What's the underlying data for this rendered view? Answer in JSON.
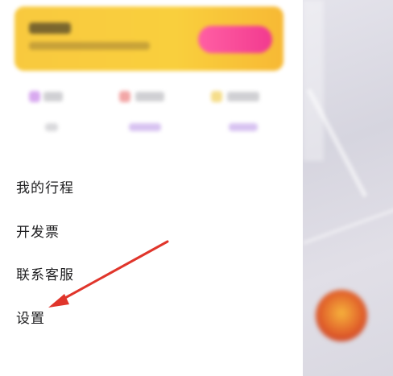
{
  "menu": {
    "items": [
      {
        "label": "我的行程"
      },
      {
        "label": "开发票"
      },
      {
        "label": "联系客服"
      },
      {
        "label": "设置"
      }
    ]
  },
  "colors": {
    "banner": "#f8c93e",
    "banner_button": "#f23a8f",
    "arrow": "#e0352b",
    "menu_text": "#1d1d1f",
    "overlay": "#dcdbe3"
  },
  "icons": {
    "quick_icon_1": "purple-icon",
    "quick_icon_2": "red-icon",
    "quick_icon_3": "yellow-icon",
    "annotation": "red-arrow-icon"
  }
}
